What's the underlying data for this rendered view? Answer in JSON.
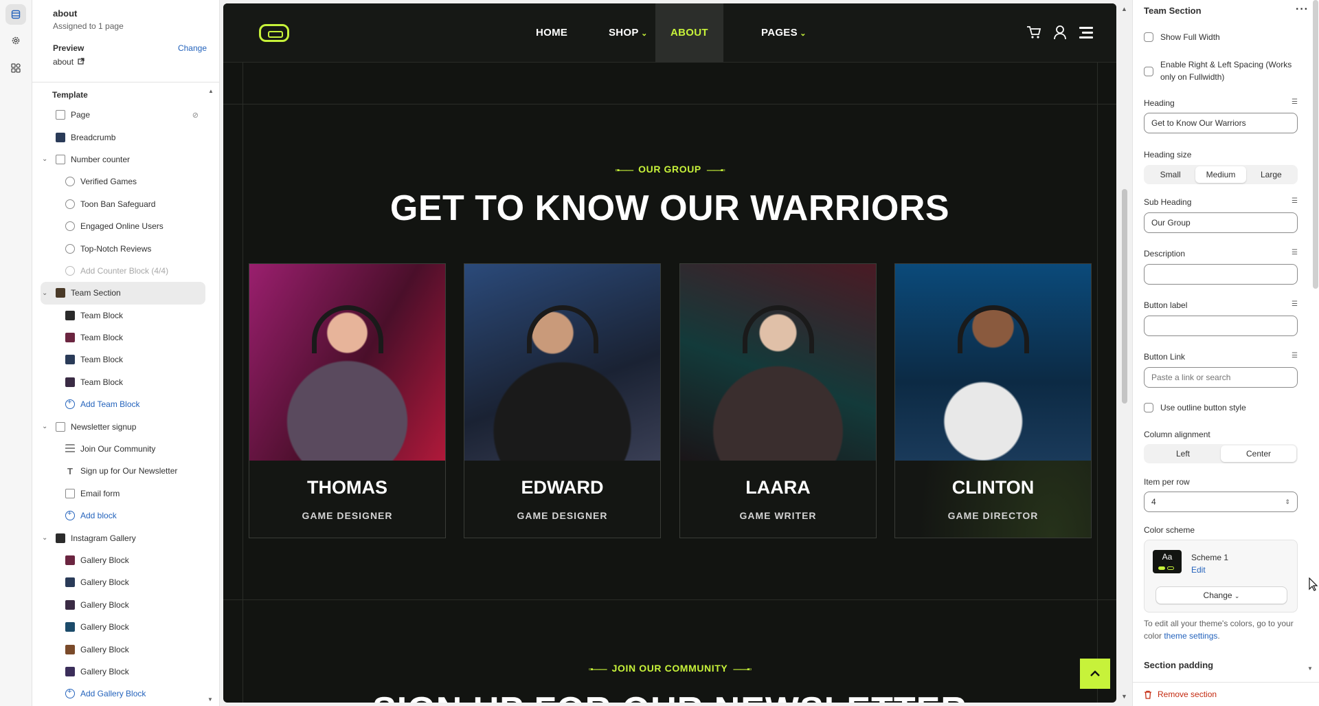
{
  "page": {
    "name": "about",
    "assigned": "Assigned to 1 page",
    "preview_label": "Preview",
    "change_label": "Change",
    "preview_value": "about"
  },
  "left_tree": {
    "section_label": "Template",
    "items": [
      {
        "label": "Page",
        "level": 1,
        "icon": "layout-icon"
      },
      {
        "label": "Breadcrumb",
        "level": 1,
        "icon": "image-thumb-icon"
      },
      {
        "label": "Number counter",
        "level": 1,
        "icon": "layout-icon",
        "expanded": true
      },
      {
        "label": "Verified Games",
        "level": 2,
        "icon": "block-icon"
      },
      {
        "label": "Toon Ban Safeguard",
        "level": 2,
        "icon": "block-icon"
      },
      {
        "label": "Engaged Online Users",
        "level": 2,
        "icon": "block-icon"
      },
      {
        "label": "Top-Notch Reviews",
        "level": 2,
        "icon": "block-icon"
      },
      {
        "label": "Add Counter Block (4/4)",
        "level": 2,
        "icon": "add-icon",
        "disabled": true
      },
      {
        "label": "Team Section",
        "level": 1,
        "icon": "image-thumb-icon",
        "expanded": true,
        "selected": true
      },
      {
        "label": "Team Block",
        "level": 2,
        "icon": "image-thumb-icon"
      },
      {
        "label": "Team Block",
        "level": 2,
        "icon": "image-thumb-icon"
      },
      {
        "label": "Team Block",
        "level": 2,
        "icon": "image-thumb-icon"
      },
      {
        "label": "Team Block",
        "level": 2,
        "icon": "image-thumb-icon"
      },
      {
        "label": "Add Team Block",
        "level": 2,
        "icon": "add-icon",
        "add": true
      },
      {
        "label": "Newsletter signup",
        "level": 1,
        "icon": "mail-icon",
        "expanded": true
      },
      {
        "label": "Join Our Community",
        "level": 2,
        "icon": "lines-icon"
      },
      {
        "label": "Sign up for Our Newsletter",
        "level": 2,
        "icon": "text-icon"
      },
      {
        "label": "Email form",
        "level": 2,
        "icon": "mail-icon"
      },
      {
        "label": "Add block",
        "level": 2,
        "icon": "add-icon",
        "add": true
      },
      {
        "label": "Instagram Gallery",
        "level": 1,
        "icon": "image-thumb-icon",
        "expanded": true
      },
      {
        "label": "Gallery Block",
        "level": 2,
        "icon": "image-thumb-icon"
      },
      {
        "label": "Gallery Block",
        "level": 2,
        "icon": "image-thumb-icon"
      },
      {
        "label": "Gallery Block",
        "level": 2,
        "icon": "image-thumb-icon"
      },
      {
        "label": "Gallery Block",
        "level": 2,
        "icon": "image-thumb-icon"
      },
      {
        "label": "Gallery Block",
        "level": 2,
        "icon": "image-thumb-icon"
      },
      {
        "label": "Gallery Block",
        "level": 2,
        "icon": "image-thumb-icon"
      },
      {
        "label": "Add Gallery Block",
        "level": 2,
        "icon": "add-icon",
        "add": true
      }
    ]
  },
  "site": {
    "nav": [
      {
        "label": "HOME"
      },
      {
        "label": "SHOP",
        "dropdown": true
      },
      {
        "label": "ABOUT",
        "active": true
      },
      {
        "label": "PAGES",
        "dropdown": true
      }
    ],
    "sub_heading": "OUR GROUP",
    "heading": "GET TO KNOW OUR WARRIORS",
    "team": [
      {
        "name": "THOMAS",
        "role": "GAME DESIGNER"
      },
      {
        "name": "EDWARD",
        "role": "GAME DESIGNER"
      },
      {
        "name": "LAARA",
        "role": "GAME WRITER"
      },
      {
        "name": "CLINTON",
        "role": "GAME DIRECTOR"
      }
    ],
    "next_sub_heading": "JOIN OUR COMMUNITY",
    "next_heading": "SIGN UP FOR OUR NEWSLETTER",
    "accent": "#c7f23a"
  },
  "settings": {
    "title": "Team Section",
    "show_full_width": "Show Full Width",
    "enable_spacing": "Enable Right & Left Spacing (Works only on Fullwidth)",
    "heading_label": "Heading",
    "heading_value": "Get to Know Our Warriors",
    "heading_size_label": "Heading size",
    "heading_sizes": [
      "Small",
      "Medium",
      "Large"
    ],
    "heading_size_selected": "Medium",
    "sub_heading_label": "Sub Heading",
    "sub_heading_value": "Our Group",
    "description_label": "Description",
    "button_label_label": "Button label",
    "button_link_label": "Button Link",
    "button_link_placeholder": "Paste a link or search",
    "outline_label": "Use outline button style",
    "column_alignment_label": "Column alignment",
    "column_alignments": [
      "Left",
      "Center"
    ],
    "column_alignment_selected": "Center",
    "item_per_row_label": "Item per row",
    "item_per_row_value": "4",
    "color_scheme_label": "Color scheme",
    "scheme_swatch_text": "Aa",
    "scheme_name": "Scheme 1",
    "scheme_edit": "Edit",
    "scheme_change": "Change",
    "help_text": "To edit all your theme's colors, go to your color ",
    "help_link": "theme settings",
    "help_end": ".",
    "section_padding_label": "Section padding",
    "remove_label": "Remove section"
  }
}
